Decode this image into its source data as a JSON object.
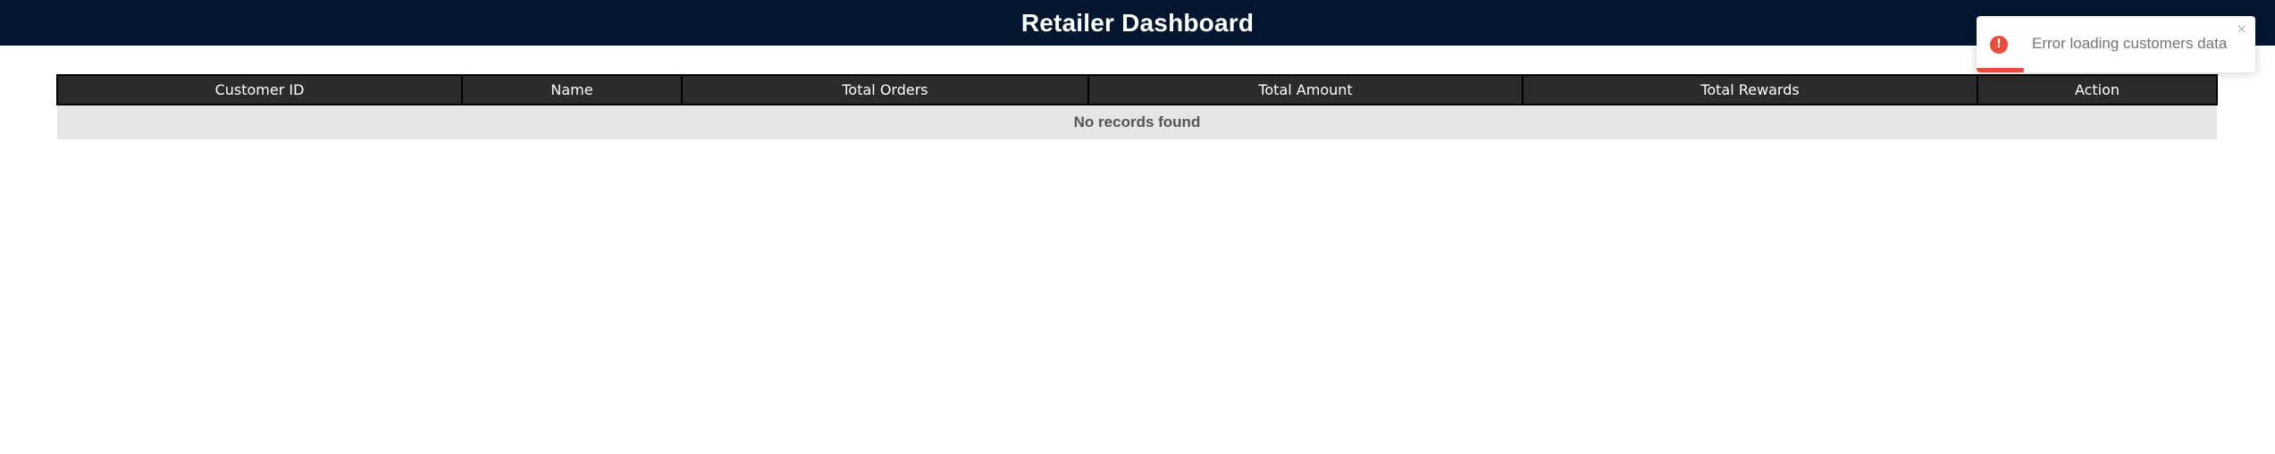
{
  "header": {
    "title": "Retailer Dashboard"
  },
  "table": {
    "columns": [
      "Customer ID",
      "Name",
      "Total Orders",
      "Total Amount",
      "Total Rewards",
      "Action"
    ],
    "empty_message": "No records found"
  },
  "toast": {
    "message": "Error loading customers data",
    "icon": "error-icon",
    "close_icon": "close-icon",
    "close_glyph": "×",
    "status_color": "#e74c3c",
    "progress": 0.17
  },
  "colors": {
    "header_bg": "#02162f",
    "table_header_bg": "#2b2b2b",
    "empty_row_bg": "#e5e5e5",
    "error": "#e74c3c"
  }
}
